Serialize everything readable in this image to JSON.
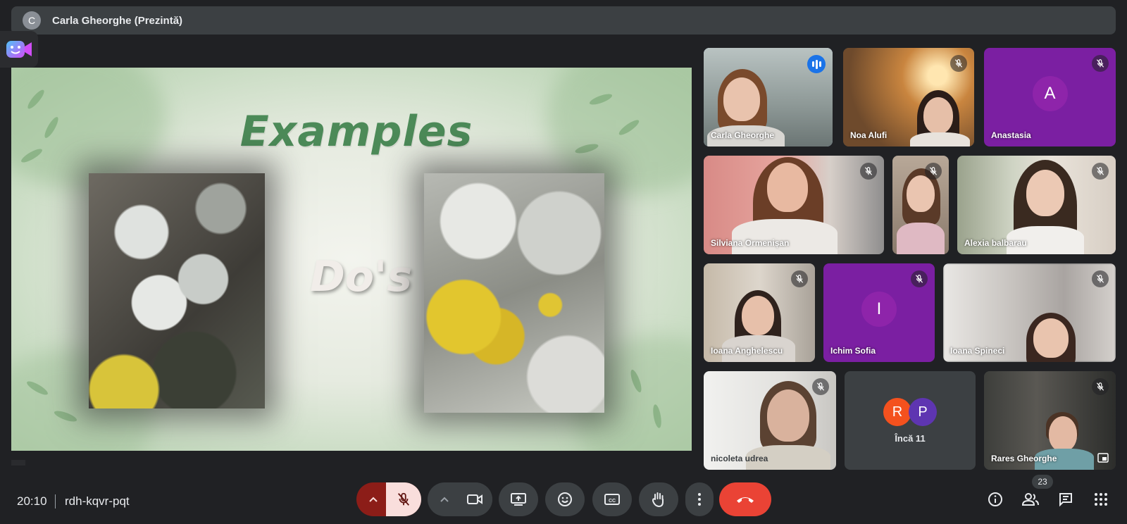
{
  "presenter": {
    "avatar_letter": "C",
    "label": "Carla Gheorghe (Prezintă)"
  },
  "slide": {
    "title": "Examples",
    "subtitle": "Do's"
  },
  "participants": [
    {
      "name": "Carla Gheorghe",
      "status": "speaking"
    },
    {
      "name": "Noa Alufi",
      "status": "muted"
    },
    {
      "name": "Anastasia",
      "status": "muted",
      "avatar_letter": "A"
    },
    {
      "name": "Silviana Ormenișan",
      "status": "muted"
    },
    {
      "name": "",
      "status": "muted"
    },
    {
      "name": "Alexia balbarau",
      "status": "muted"
    },
    {
      "name": "Ioana Anghelescu",
      "status": "muted"
    },
    {
      "name": "Ichim Sofia",
      "status": "muted",
      "avatar_letter": "I"
    },
    {
      "name": "Ioana Spineci",
      "status": "muted"
    },
    {
      "name": "nicoleta udrea",
      "status": "muted"
    },
    {
      "name": "Rares Gheorghe",
      "status": "muted"
    }
  ],
  "more": {
    "avatars": [
      "R",
      "P"
    ],
    "label": "Încă 11"
  },
  "meeting": {
    "time": "20:10",
    "code": "rdh-kqvr-pqt"
  },
  "people_count": "23",
  "colors": {
    "end_call": "#ea4335",
    "mic_off_bg": "#f9dedc",
    "mic_group": "#8c1d18",
    "avatar_purple": "#8e24aa",
    "speaking": "#1a73e8"
  },
  "controls": [
    "mic-options",
    "microphone",
    "camera-options",
    "camera",
    "present-screen",
    "reactions",
    "captions",
    "raise-hand",
    "more-options",
    "leave-call"
  ],
  "right_controls": [
    "info-icon",
    "people-icon",
    "chat-icon",
    "activities-icon"
  ]
}
